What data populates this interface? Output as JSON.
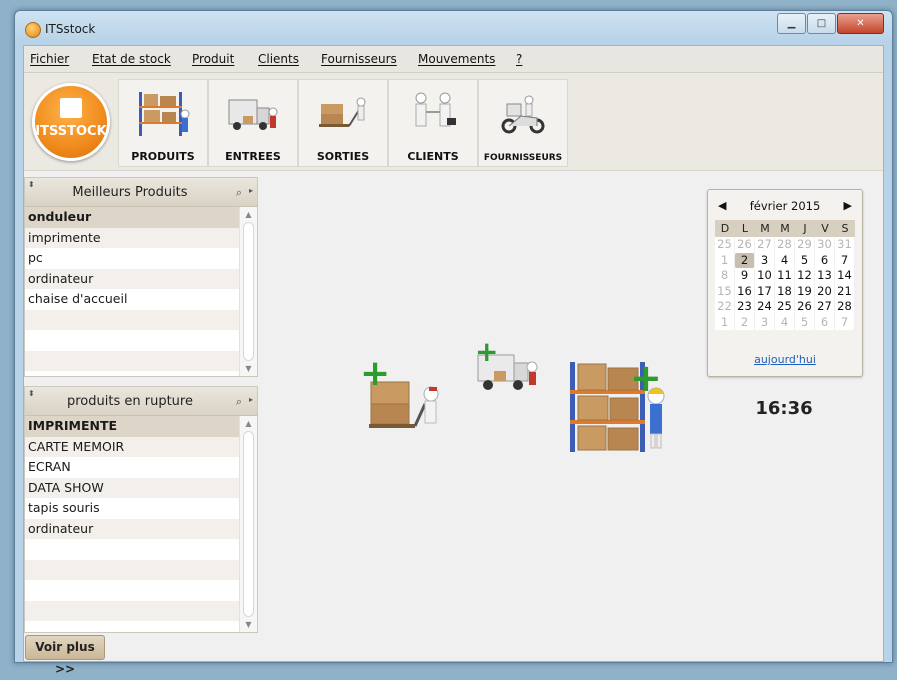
{
  "window": {
    "title": "ITSstock",
    "controls": {
      "minimize": "▁",
      "maximize": "□",
      "close": "✕"
    }
  },
  "menu": [
    "Fichier",
    "Etat de stock",
    "Produit",
    "Clients",
    "Fournisseurs",
    "Mouvements",
    "?"
  ],
  "logo": {
    "text": "ITSSTOCK"
  },
  "toolbar": {
    "buttons": [
      "PRODUITS",
      "ENTREES",
      "SORTIES",
      "CLIENTS",
      "FOURNISSEURS"
    ]
  },
  "best_products": {
    "title": "Meilleurs Produits",
    "items": [
      "onduleur",
      "imprimente",
      "pc",
      "ordinateur",
      "chaise d'accueil"
    ]
  },
  "out_of_stock": {
    "title": "produits en rupture",
    "items": [
      "IMPRIMENTE",
      "CARTE MEMOIR",
      "ECRAN",
      "DATA SHOW",
      "tapis souris",
      "ordinateur"
    ]
  },
  "more_button": "Voir plus >>",
  "calendar": {
    "month": "février 2015",
    "weekdays": [
      "D",
      "L",
      "M",
      "M",
      "J",
      "V",
      "S"
    ],
    "weeks": [
      [
        "25",
        "26",
        "27",
        "28",
        "29",
        "30",
        "31"
      ],
      [
        "1",
        "2",
        "3",
        "4",
        "5",
        "6",
        "7"
      ],
      [
        "8",
        "9",
        "10",
        "11",
        "12",
        "13",
        "14"
      ],
      [
        "15",
        "16",
        "17",
        "18",
        "19",
        "20",
        "21"
      ],
      [
        "22",
        "23",
        "24",
        "25",
        "26",
        "27",
        "28"
      ],
      [
        "1",
        "2",
        "3",
        "4",
        "5",
        "6",
        "7"
      ]
    ],
    "today": "2",
    "today_link": "aujourd'hui"
  },
  "clock": "16:36"
}
